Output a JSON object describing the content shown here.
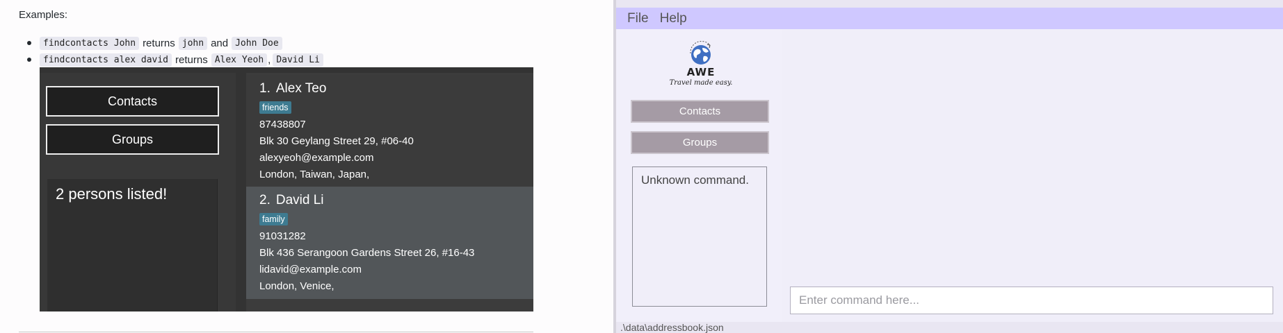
{
  "docs": {
    "heading": "Examples:",
    "examples": [
      {
        "cmd": "findcontacts John",
        "returns": "returns",
        "results": [
          "john",
          "John Doe"
        ],
        "joiner": "and"
      },
      {
        "cmd": "findcontacts alex david",
        "returns": "returns",
        "results": [
          "Alex Yeoh",
          "David Li"
        ],
        "joiner": ","
      }
    ]
  },
  "screenshot": {
    "buttons": {
      "contacts": "Contacts",
      "groups": "Groups"
    },
    "result": "2 persons listed!",
    "persons": [
      {
        "index": "1.",
        "name": "Alex Teo",
        "tag": "friends",
        "phone": "87438807",
        "address": "Blk 30 Geylang Street 29, #06-40",
        "email": "alexyeoh@example.com",
        "places": "London, Taiwan, Japan,"
      },
      {
        "index": "2.",
        "name": "David Li",
        "tag": "family",
        "phone": "91031282",
        "address": "Blk 436 Serangoon Gardens Street 26, #16-43",
        "email": "lidavid@example.com",
        "places": "London, Venice,"
      }
    ]
  },
  "app": {
    "menu": {
      "file": "File",
      "help": "Help"
    },
    "logo": {
      "title": "AWE",
      "tagline": "Travel made easy."
    },
    "buttons": {
      "contacts": "Contacts",
      "groups": "Groups"
    },
    "result": "Unknown command.",
    "command_placeholder": "Enter command here...",
    "status_path": ".\\data\\addressbook.json"
  },
  "colors": {
    "menu_bar": "#cfc8ff",
    "side_button": "#a59ba5",
    "tag": "#3e7b91",
    "dark_panel": "#383838"
  }
}
